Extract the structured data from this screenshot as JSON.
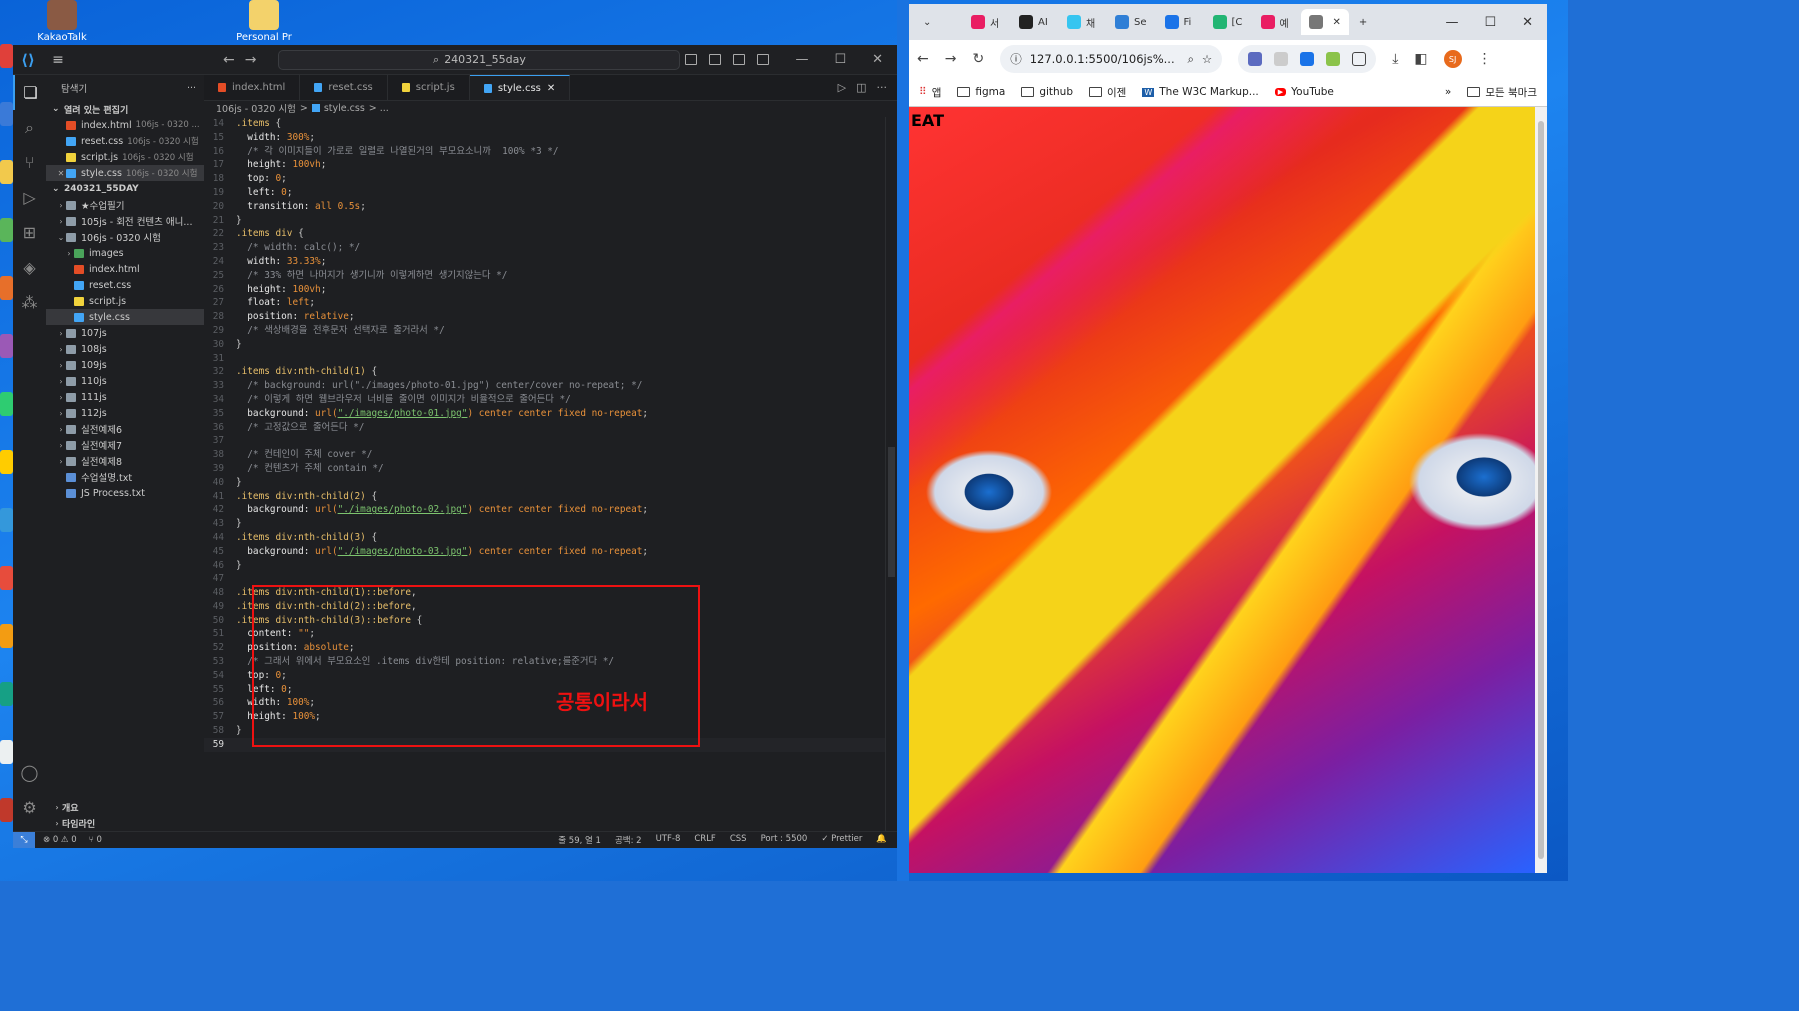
{
  "desktop": {
    "icons": [
      {
        "label": "KakaoTalk"
      },
      {
        "label": "Personal Pr"
      }
    ]
  },
  "vscode": {
    "search_text": "240321_55day",
    "explorer_title": "탐색기",
    "open_editors_title": "열려 있는 편집기",
    "open_editors": [
      {
        "name": "index.html",
        "desc": "106js - 0320 ...",
        "type": "html"
      },
      {
        "name": "reset.css",
        "desc": "106js - 0320 시험",
        "type": "css"
      },
      {
        "name": "script.js",
        "desc": "106js - 0320 시험",
        "type": "js"
      },
      {
        "name": "style.css",
        "desc": "106js - 0320 시험",
        "type": "css"
      }
    ],
    "workspace_title": "240321_55DAY",
    "tree": [
      {
        "name": "★수업필기",
        "type": "folder",
        "indent": 1
      },
      {
        "name": "105js - 회전 컨텐츠 애니...",
        "type": "folder",
        "indent": 1
      },
      {
        "name": "106js - 0320 시험",
        "type": "folder",
        "indent": 1,
        "open": true
      },
      {
        "name": "images",
        "type": "imgf",
        "indent": 2
      },
      {
        "name": "index.html",
        "type": "html",
        "indent": 2
      },
      {
        "name": "reset.css",
        "type": "css",
        "indent": 2
      },
      {
        "name": "script.js",
        "type": "js",
        "indent": 2
      },
      {
        "name": "style.css",
        "type": "css",
        "indent": 2,
        "selected": true
      },
      {
        "name": "107js",
        "type": "folder",
        "indent": 1
      },
      {
        "name": "108js",
        "type": "folder",
        "indent": 1
      },
      {
        "name": "109js",
        "type": "folder",
        "indent": 1
      },
      {
        "name": "110js",
        "type": "folder",
        "indent": 1
      },
      {
        "name": "111js",
        "type": "folder",
        "indent": 1
      },
      {
        "name": "112js",
        "type": "folder",
        "indent": 1
      },
      {
        "name": "실전예제6",
        "type": "folder",
        "indent": 1
      },
      {
        "name": "실전예제7",
        "type": "folder",
        "indent": 1
      },
      {
        "name": "실전예제8",
        "type": "folder",
        "indent": 1
      },
      {
        "name": "수업설명.txt",
        "type": "txt",
        "indent": 1
      },
      {
        "name": "JS Process.txt",
        "type": "txt",
        "indent": 1
      }
    ],
    "outline_label": "개요",
    "timeline_label": "타임라인",
    "tabs": [
      {
        "name": "index.html",
        "type": "html"
      },
      {
        "name": "reset.css",
        "type": "css"
      },
      {
        "name": "script.js",
        "type": "js"
      },
      {
        "name": "style.css",
        "type": "css",
        "active": true
      }
    ],
    "breadcrumb": [
      "106js - 0320 시험",
      ">",
      "style.css",
      "> ..."
    ],
    "code_lines": [
      {
        "n": "14",
        "t": [
          [
            "sel-c",
            ".items "
          ],
          [
            "pun",
            "{"
          ]
        ]
      },
      {
        "n": "15",
        "t": [
          [
            "prop",
            "  width: "
          ],
          [
            "val",
            "300%"
          ],
          [
            "pun",
            ";"
          ]
        ]
      },
      {
        "n": "16",
        "t": [
          [
            "cmt",
            "  /* 각 이미지들이 가로로 일렬로 나열된거의 부모요소니까  100% *3 */"
          ]
        ]
      },
      {
        "n": "17",
        "t": [
          [
            "prop",
            "  height: "
          ],
          [
            "val",
            "100vh"
          ],
          [
            "pun",
            ";"
          ]
        ]
      },
      {
        "n": "18",
        "t": [
          [
            "prop",
            "  top: "
          ],
          [
            "val",
            "0"
          ],
          [
            "pun",
            ";"
          ]
        ]
      },
      {
        "n": "19",
        "t": [
          [
            "prop",
            "  left: "
          ],
          [
            "val",
            "0"
          ],
          [
            "pun",
            ";"
          ]
        ]
      },
      {
        "n": "20",
        "t": [
          [
            "prop",
            "  transition: "
          ],
          [
            "val",
            "all 0.5s"
          ],
          [
            "pun",
            ";"
          ]
        ]
      },
      {
        "n": "21",
        "t": [
          [
            "pun",
            "}"
          ]
        ]
      },
      {
        "n": "22",
        "t": [
          [
            "sel-c",
            ".items div "
          ],
          [
            "pun",
            "{"
          ]
        ]
      },
      {
        "n": "23",
        "t": [
          [
            "cmt",
            "  /* width: calc(); */"
          ]
        ]
      },
      {
        "n": "24",
        "t": [
          [
            "prop",
            "  width: "
          ],
          [
            "val",
            "33.33%"
          ],
          [
            "pun",
            ";"
          ]
        ]
      },
      {
        "n": "25",
        "t": [
          [
            "cmt",
            "  /* 33% 하면 나머지가 생기니까 이렇게하면 생기지않는다 */"
          ]
        ]
      },
      {
        "n": "26",
        "t": [
          [
            "prop",
            "  height: "
          ],
          [
            "val",
            "100vh"
          ],
          [
            "pun",
            ";"
          ]
        ]
      },
      {
        "n": "27",
        "t": [
          [
            "prop",
            "  float: "
          ],
          [
            "val",
            "left"
          ],
          [
            "pun",
            ";"
          ]
        ]
      },
      {
        "n": "28",
        "t": [
          [
            "prop",
            "  position: "
          ],
          [
            "val",
            "relative"
          ],
          [
            "pun",
            ";"
          ]
        ]
      },
      {
        "n": "29",
        "t": [
          [
            "cmt",
            "  /* 색상배경을 전후문자 선택자로 줄거라서 */"
          ]
        ]
      },
      {
        "n": "30",
        "t": [
          [
            "pun",
            "}"
          ]
        ]
      },
      {
        "n": "31",
        "t": []
      },
      {
        "n": "32",
        "t": [
          [
            "sel-c",
            ".items div:nth-child(1) "
          ],
          [
            "pun",
            "{"
          ]
        ]
      },
      {
        "n": "33",
        "t": [
          [
            "cmt",
            "  /* background: url(\"./images/photo-01.jpg\") center/cover no-repeat; */"
          ]
        ]
      },
      {
        "n": "34",
        "t": [
          [
            "cmt",
            "  /* 이렇게 하면 웹브라우저 너비를 줄이면 이미지가 비율적으로 줄어든다 */"
          ]
        ]
      },
      {
        "n": "35",
        "t": [
          [
            "prop",
            "  background: "
          ],
          [
            "val",
            "url("
          ],
          [
            "str",
            "\"./images/photo-01.jpg\""
          ],
          [
            "val",
            ") center center fixed no-repeat"
          ],
          [
            "pun",
            ";"
          ]
        ]
      },
      {
        "n": "36",
        "t": [
          [
            "cmt",
            "  /* 고정값으로 줄어든다 */"
          ]
        ]
      },
      {
        "n": "37",
        "t": []
      },
      {
        "n": "38",
        "t": [
          [
            "cmt",
            "  /* 컨테인이 주체 cover */"
          ]
        ]
      },
      {
        "n": "39",
        "t": [
          [
            "cmt",
            "  /* 컨텐츠가 주체 contain */"
          ]
        ]
      },
      {
        "n": "40",
        "t": [
          [
            "pun",
            "}"
          ]
        ]
      },
      {
        "n": "41",
        "t": [
          [
            "sel-c",
            ".items div:nth-child(2) "
          ],
          [
            "pun",
            "{"
          ]
        ]
      },
      {
        "n": "42",
        "t": [
          [
            "prop",
            "  background: "
          ],
          [
            "val",
            "url("
          ],
          [
            "str",
            "\"./images/photo-02.jpg\""
          ],
          [
            "val",
            ") center center fixed no-repeat"
          ],
          [
            "pun",
            ";"
          ]
        ]
      },
      {
        "n": "43",
        "t": [
          [
            "pun",
            "}"
          ]
        ]
      },
      {
        "n": "44",
        "t": [
          [
            "sel-c",
            ".items div:nth-child(3) "
          ],
          [
            "pun",
            "{"
          ]
        ]
      },
      {
        "n": "45",
        "t": [
          [
            "prop",
            "  background: "
          ],
          [
            "val",
            "url("
          ],
          [
            "str",
            "\"./images/photo-03.jpg\""
          ],
          [
            "val",
            ") center center fixed no-repeat"
          ],
          [
            "pun",
            ";"
          ]
        ]
      },
      {
        "n": "46",
        "t": [
          [
            "pun",
            "}"
          ]
        ]
      },
      {
        "n": "47",
        "t": []
      },
      {
        "n": "48",
        "t": [
          [
            "sel-c",
            ".items div:nth-child(1)::before"
          ],
          [
            "pun",
            ","
          ]
        ]
      },
      {
        "n": "49",
        "t": [
          [
            "sel-c",
            ".items div:nth-child(2)::before"
          ],
          [
            "pun",
            ","
          ]
        ]
      },
      {
        "n": "50",
        "t": [
          [
            "sel-c",
            ".items div:nth-child(3)::before "
          ],
          [
            "pun",
            "{"
          ]
        ]
      },
      {
        "n": "51",
        "t": [
          [
            "prop",
            "  content: "
          ],
          [
            "val",
            "\"\""
          ],
          [
            "pun",
            ";"
          ]
        ]
      },
      {
        "n": "52",
        "t": [
          [
            "prop",
            "  position: "
          ],
          [
            "val",
            "absolute"
          ],
          [
            "pun",
            ";"
          ]
        ]
      },
      {
        "n": "53",
        "t": [
          [
            "cmt",
            "  /* 그래서 위에서 부모요소인 .items div한테 position: relative;를준거다 */"
          ]
        ]
      },
      {
        "n": "54",
        "t": [
          [
            "prop",
            "  top: "
          ],
          [
            "val",
            "0"
          ],
          [
            "pun",
            ";"
          ]
        ]
      },
      {
        "n": "55",
        "t": [
          [
            "prop",
            "  left: "
          ],
          [
            "val",
            "0"
          ],
          [
            "pun",
            ";"
          ]
        ]
      },
      {
        "n": "56",
        "t": [
          [
            "prop",
            "  width: "
          ],
          [
            "val",
            "100%"
          ],
          [
            "pun",
            ";"
          ]
        ]
      },
      {
        "n": "57",
        "t": [
          [
            "prop",
            "  height: "
          ],
          [
            "val",
            "100%"
          ],
          [
            "pun",
            ";"
          ]
        ]
      },
      {
        "n": "58",
        "t": [
          [
            "pun",
            "}"
          ]
        ]
      },
      {
        "n": "59",
        "t": [],
        "current": true
      }
    ],
    "annotation_label": "공통이라서",
    "status": {
      "problems": "⊗ 0 ⚠ 0",
      "ports": "⑂ 0",
      "position": "줄 59, 열 1",
      "spaces": "공백: 2",
      "encoding": "UTF-8",
      "eol": "CRLF",
      "language": "CSS",
      "port": "Port : 5500",
      "prettier": "✓ Prettier"
    },
    "accent_color": "#3b9ff0"
  },
  "browser": {
    "tabs": [
      {
        "label": "서",
        "color": "#e91e63"
      },
      {
        "label": "AI",
        "color": "#222222"
      },
      {
        "label": "채",
        "color": "#36c5f0"
      },
      {
        "label": "Se",
        "color": "#2f7fd6"
      },
      {
        "label": "Fi",
        "color": "#1a73e8"
      },
      {
        "label": "[C",
        "color": "#22b573"
      },
      {
        "label": "예",
        "color": "#e91e63"
      },
      {
        "label": "",
        "color": "#777777",
        "active": true
      }
    ],
    "address": "127.0.0.1:5500/106js%...",
    "bookmarks": [
      {
        "label": "앱",
        "kind": "apps"
      },
      {
        "label": "figma",
        "kind": "folder"
      },
      {
        "label": "github",
        "kind": "folder"
      },
      {
        "label": "이젠",
        "kind": "folder"
      },
      {
        "label": "The W3C Markup...",
        "kind": "w3c"
      },
      {
        "label": "YouTube",
        "kind": "youtube"
      }
    ],
    "all_bookmarks_label": "모든 북마크",
    "avatar_initials": "SJ",
    "page_overlay_text": "EAT"
  }
}
